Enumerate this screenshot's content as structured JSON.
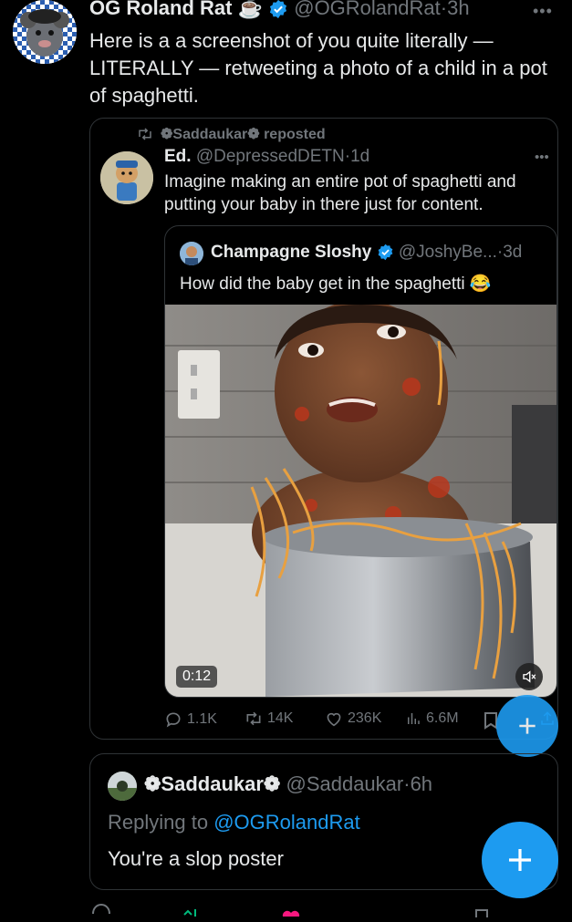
{
  "main_post": {
    "author_name": "OG Roland Rat",
    "author_emoji": "☕",
    "handle": "@OGRolandRat",
    "time": "3h",
    "text": "Here is a a screenshot of you quite literally — LITERALLY — retweeting a photo of a child in a pot of spaghetti."
  },
  "repost_card": {
    "reposted_by": "❁Saddaukar❁ reposted",
    "author_name": "Ed.",
    "handle": "@DepressedDETN",
    "time": "1d",
    "text": "Imagine making an entire pot of spaghetti and putting your baby in there just for content.",
    "quoted": {
      "author_name": "Champagne Sloshy",
      "handle": "@JoshyBe...",
      "time": "3d",
      "text": "How did the baby get in the spaghetti 😂",
      "video_duration": "0:12"
    },
    "stats": {
      "replies": "1.1K",
      "reposts": "14K",
      "likes": "236K",
      "views": "6.6M"
    }
  },
  "reply_card": {
    "author_name": "❁Saddaukar❁",
    "handle": "@Saddaukar",
    "time": "6h",
    "replying_prefix": "Replying to",
    "replying_to": "@OGRolandRat",
    "text": "You're a slop poster"
  },
  "colors": {
    "accent": "#1d9bf0",
    "muted": "#71767b",
    "border": "#2f3336",
    "like": "#f91880"
  },
  "icons": [
    "more-icon",
    "verified-icon",
    "repost-icon",
    "reply-icon",
    "like-icon",
    "views-icon",
    "bookmark-icon",
    "share-icon",
    "mute-icon",
    "plus-icon"
  ]
}
